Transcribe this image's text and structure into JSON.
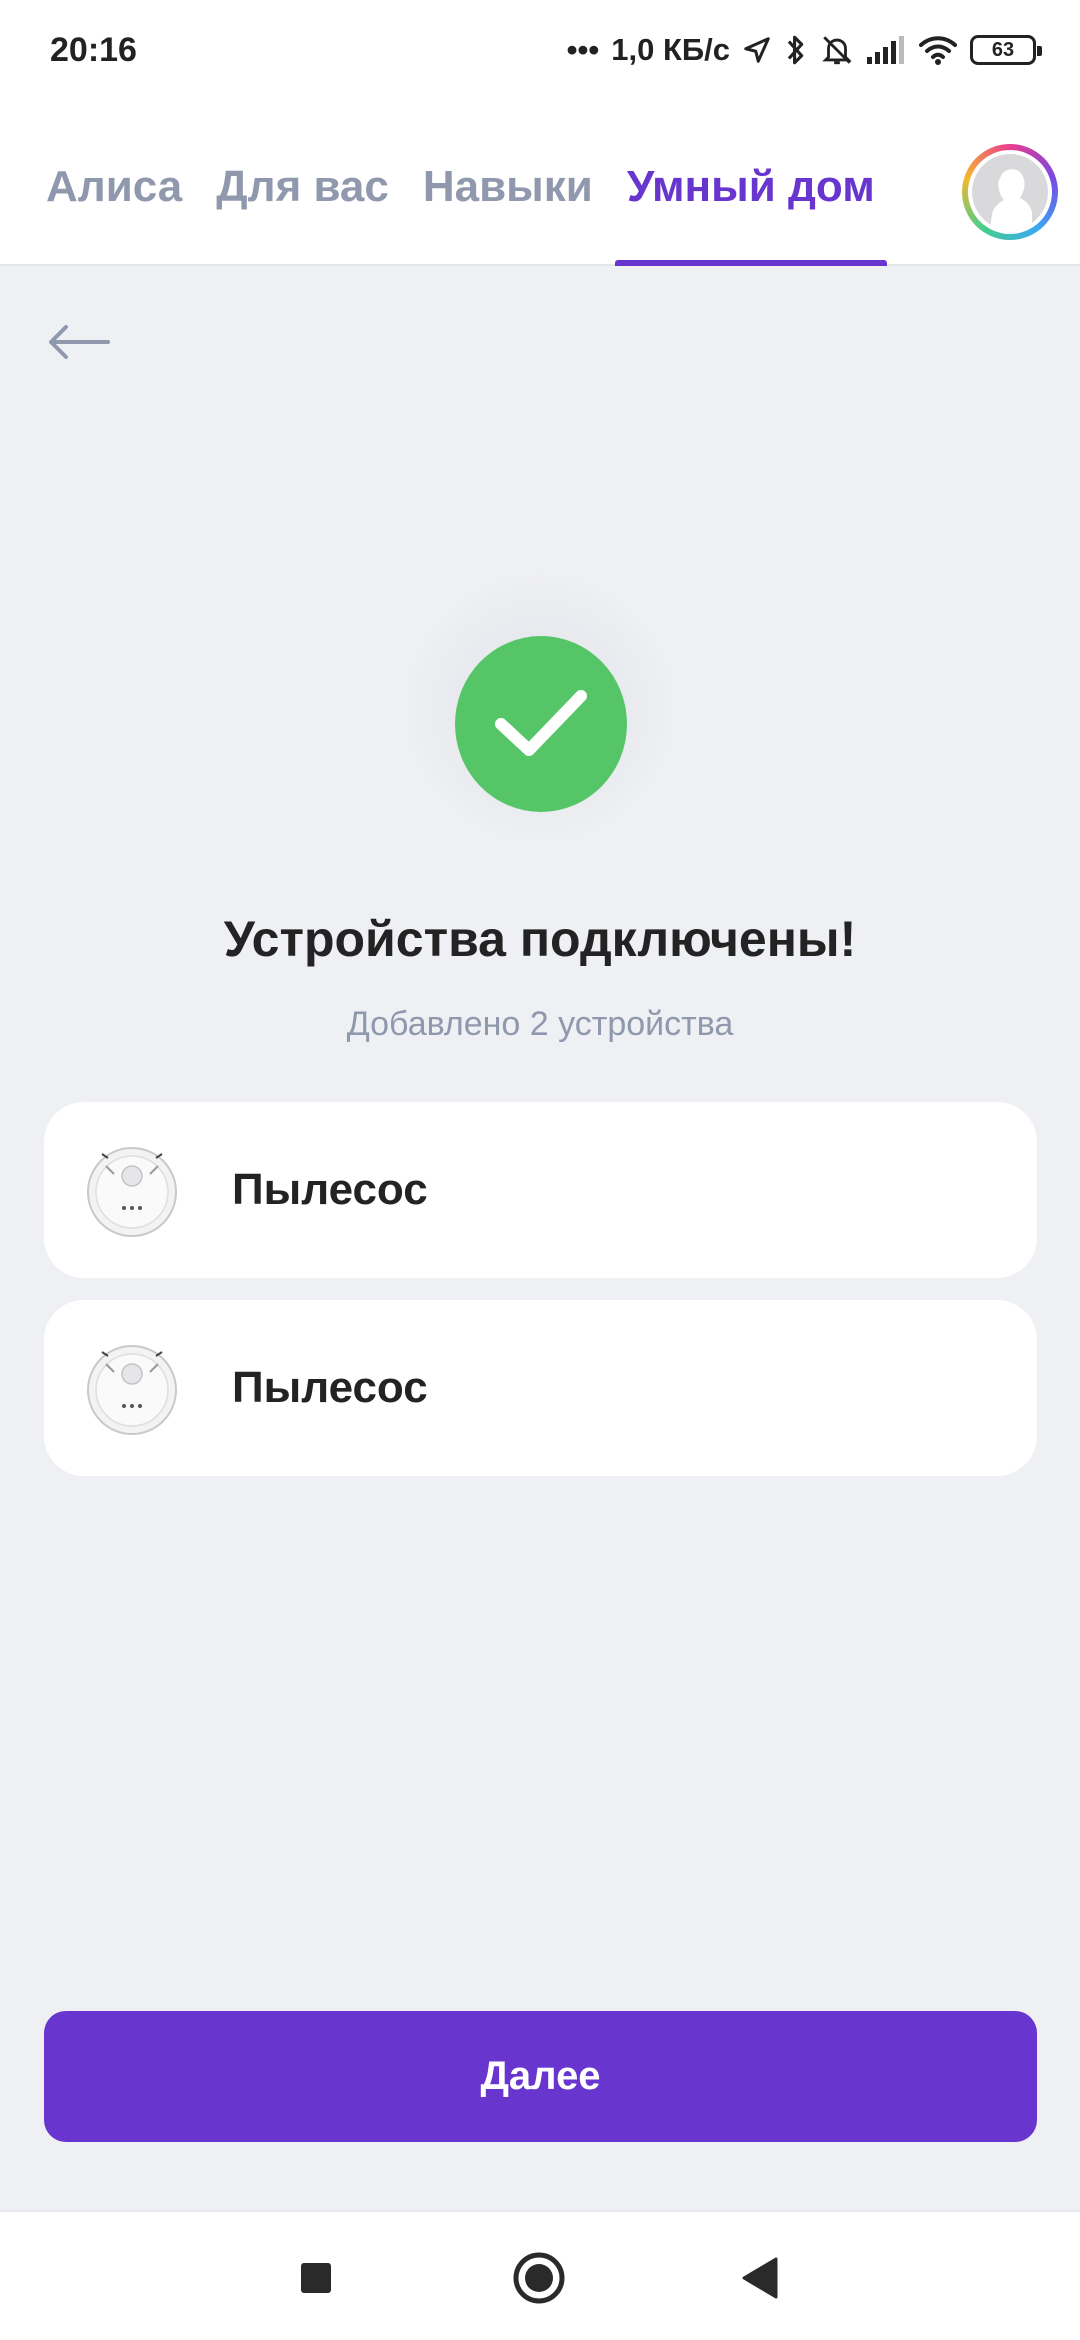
{
  "status_bar": {
    "time": "20:16",
    "dots": "•••",
    "speed": "1,0 КБ/с",
    "battery": "63",
    "icons": [
      "location-icon",
      "bluetooth-icon",
      "bell-muted-icon",
      "signal-icon",
      "wifi-icon",
      "battery-icon"
    ]
  },
  "tabs": [
    {
      "label": "Алиса",
      "active": false
    },
    {
      "label": "Для вас",
      "active": false
    },
    {
      "label": "Навыки",
      "active": false
    },
    {
      "label": "Умный дом",
      "active": true
    }
  ],
  "main": {
    "title": "Устройства подключены!",
    "subtitle": "Добавлено 2 устройства",
    "devices": [
      {
        "name": "Пылесос",
        "icon": "robot-vacuum-icon"
      },
      {
        "name": "Пылесос",
        "icon": "robot-vacuum-icon"
      }
    ],
    "next_label": "Далее"
  },
  "colors": {
    "accent": "#6835cf",
    "success": "#56c568",
    "background": "#eff0f3",
    "muted_text": "#8f98ad"
  }
}
